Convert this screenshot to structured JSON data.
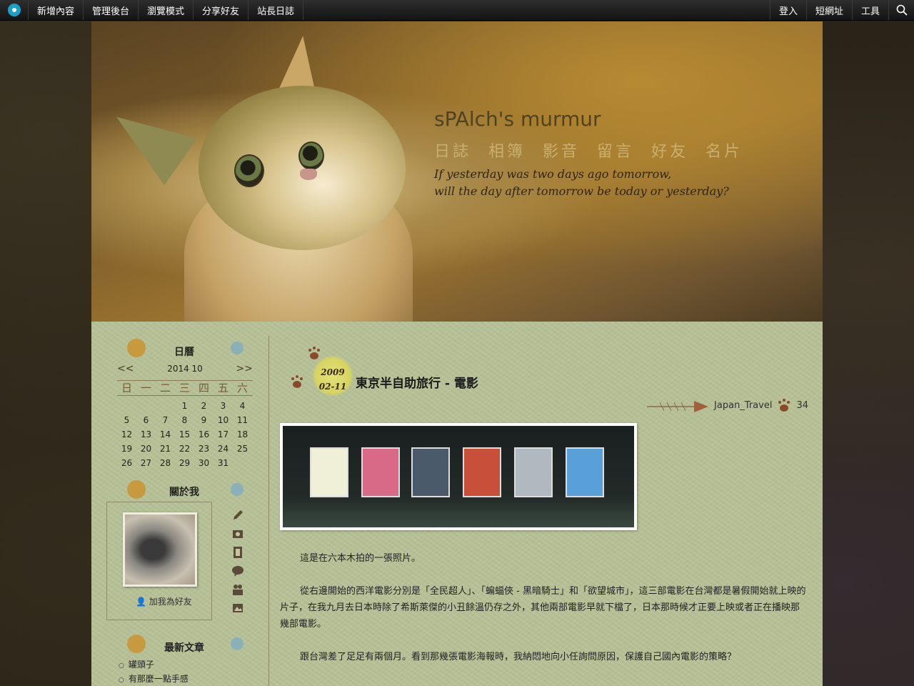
{
  "topbar": {
    "left_items": [
      "新增內容",
      "管理後台",
      "瀏覽模式",
      "分享好友",
      "站長日誌"
    ],
    "right_items": [
      "登入",
      "短網址",
      "工具"
    ]
  },
  "banner": {
    "title": "sPAlch's murmur",
    "nav": [
      "日誌",
      "相簿",
      "影音",
      "留言",
      "好友",
      "名片"
    ],
    "tagline_1": "If yesterday was two days ago tomorrow,",
    "tagline_2": "will the day after tomorrow be today or yesterday?"
  },
  "sidebar": {
    "calendar_title": "日曆",
    "calendar_month": "2014 10",
    "prev": "<<",
    "next": ">>",
    "weekdays": [
      "日",
      "一",
      "二",
      "三",
      "四",
      "五",
      "六"
    ],
    "days": [
      "",
      "",
      "",
      "1",
      "2",
      "3",
      "4",
      "5",
      "6",
      "7",
      "8",
      "9",
      "10",
      "11",
      "12",
      "13",
      "14",
      "15",
      "16",
      "17",
      "18",
      "19",
      "20",
      "21",
      "22",
      "23",
      "24",
      "25",
      "26",
      "27",
      "28",
      "29",
      "30",
      "31",
      ""
    ],
    "about_title": "關於我",
    "add_friend": "加我為好友",
    "recent_title": "最新文章",
    "recent_posts": [
      "罐頭子",
      "有那麼一點手感"
    ]
  },
  "post": {
    "year": "2009",
    "date": "02-11",
    "title": "東京半自助旅行 - 電影",
    "category": "Japan_Travel",
    "count": "34",
    "paragraphs": [
      "這是在六本木拍的一張照片。",
      "從右邊開始的西洋電影分別是「全民超人」、「蝙蝠俠 - 黑暗騎士」和「欲望城市」，這三部電影在台灣都是暑假開始就上映的片子，在我九月去日本時除了希斯萊傑的小丑餘溫仍存之外，其他兩部電影早就下檔了，日本那時候才正要上映或者正在播映那幾部電影。",
      "跟台灣差了足足有兩個月。看到那幾張電影海報時，我納悶地向小任詢問原因，保護自己國內電影的策略？"
    ]
  }
}
